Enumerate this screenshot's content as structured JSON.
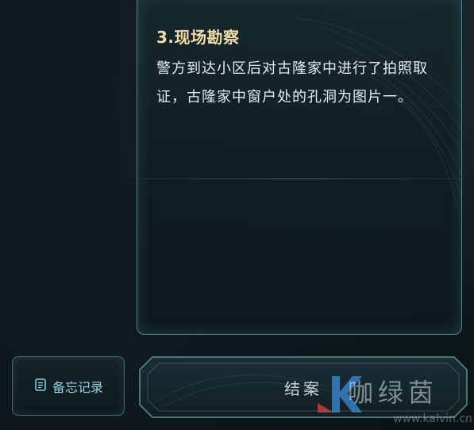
{
  "panel": {
    "section_title": "3.现场勘察",
    "section_body": "警方到达小区后对古隆家中进行了拍照取证，古隆家中窗户处的孔洞为图片一。"
  },
  "buttons": {
    "memo_label": "备忘记录",
    "memo_icon": "notebook-icon",
    "close_label": "结案"
  },
  "watermark": {
    "text": "咖绿茵",
    "url": "www.kalvin.cn"
  },
  "colors": {
    "title": "#f1dca6",
    "body": "#e6edf0",
    "accent": "#8fd3e0",
    "border": "#4f8b86"
  }
}
